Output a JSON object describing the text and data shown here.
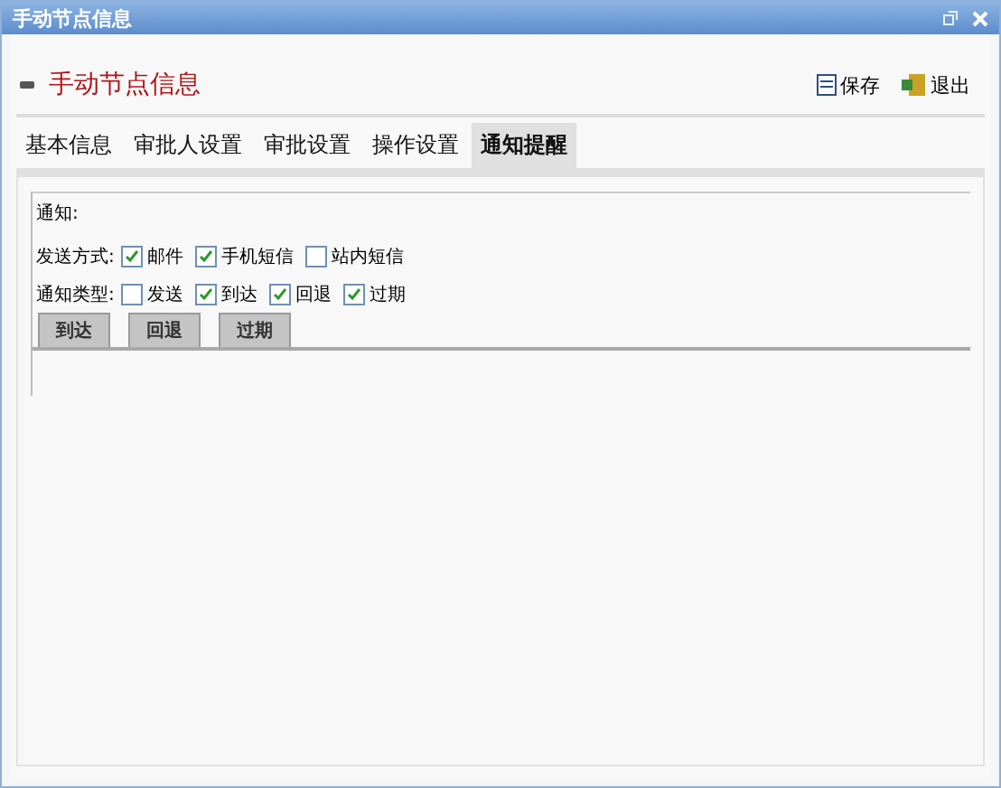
{
  "window": {
    "title": "手动节点信息"
  },
  "header": {
    "title": "手动节点信息",
    "buttons": [
      {
        "label": "保存",
        "kind": "save"
      },
      {
        "label": "退出",
        "kind": "exit"
      }
    ]
  },
  "tabs": [
    {
      "label": "基本信息",
      "selected": false
    },
    {
      "label": "审批人设置",
      "selected": false
    },
    {
      "label": "审批设置",
      "selected": false
    },
    {
      "label": "操作设置",
      "selected": false
    },
    {
      "label": "通知提醒",
      "selected": true
    }
  ],
  "notify": {
    "title": "通知:",
    "rows": [
      {
        "label": "发送方式:",
        "options": [
          {
            "label": "邮件",
            "checked": true
          },
          {
            "label": "手机短信",
            "checked": true
          },
          {
            "label": "站内短信",
            "checked": false
          }
        ]
      },
      {
        "label": "通知类型:",
        "options": [
          {
            "label": "发送",
            "checked": false
          },
          {
            "label": "到达",
            "checked": true
          },
          {
            "label": "回退",
            "checked": true
          },
          {
            "label": "过期",
            "checked": true
          }
        ]
      }
    ],
    "subtabs": [
      {
        "label": "到达"
      },
      {
        "label": "回退"
      },
      {
        "label": "过期"
      }
    ]
  }
}
